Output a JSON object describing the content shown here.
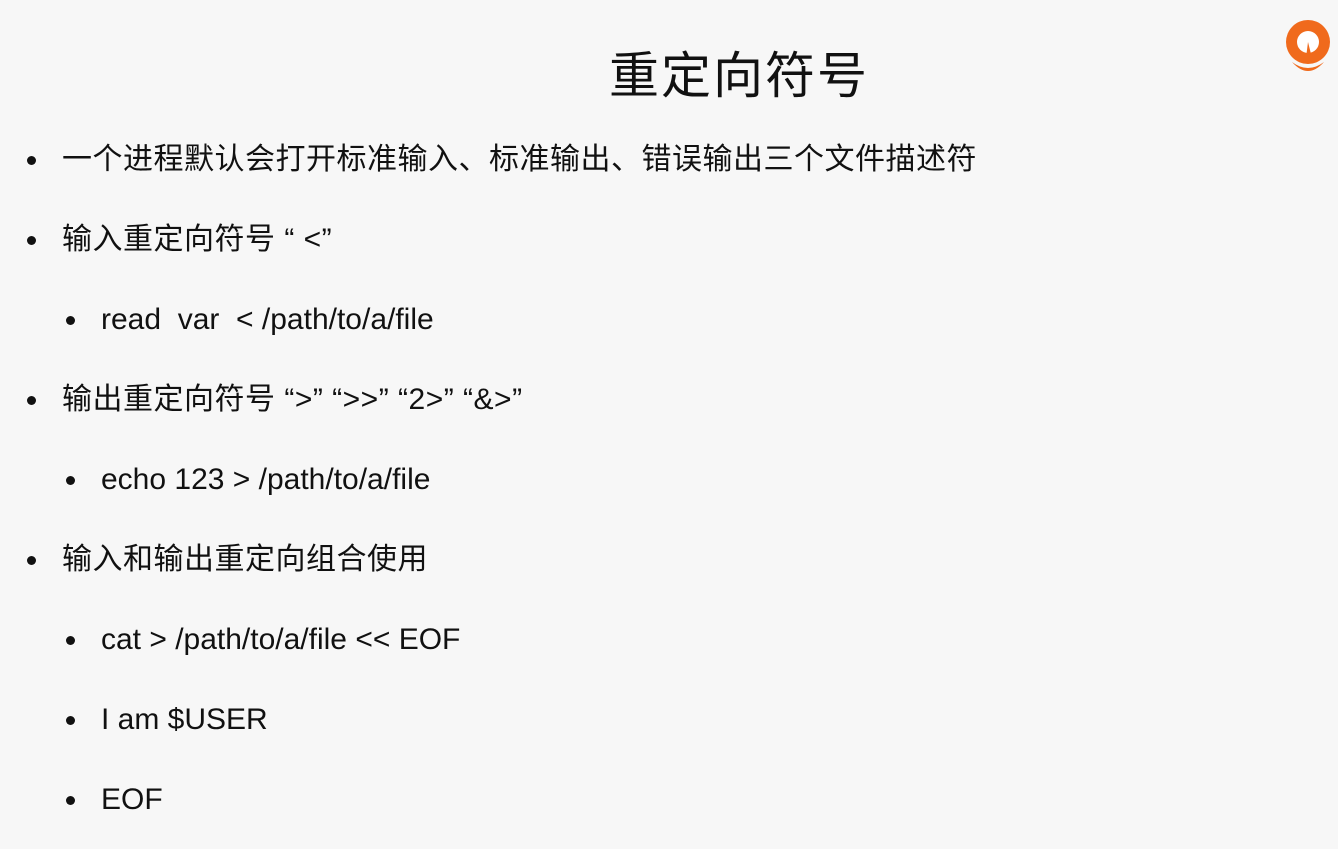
{
  "slide": {
    "title": "重定向符号",
    "items": [
      {
        "level": 1,
        "text": "一个进程默认会打开标准输入、标准输出、错误输出三个文件描述符"
      },
      {
        "level": 1,
        "text": "输入重定向符号 “ <”"
      },
      {
        "level": 2,
        "text": "read  var  < /path/to/a/file"
      },
      {
        "level": 1,
        "text": "输出重定向符号 “>” “>>” “2>” “&>”"
      },
      {
        "level": 2,
        "text": "echo 123 > /path/to/a/file"
      },
      {
        "level": 1,
        "text": "输入和输出重定向组合使用"
      },
      {
        "level": 2,
        "text": "cat > /path/to/a/file << EOF"
      },
      {
        "level": 2,
        "text": "I am $USER"
      },
      {
        "level": 2,
        "text": "EOF"
      }
    ]
  },
  "logo": {
    "icon": "orange-location-pin-logo",
    "color_outer": "#f06a1c",
    "color_inner": "#ffffff"
  },
  "colors": {
    "background": "#f7f7f7",
    "text": "#111111"
  }
}
